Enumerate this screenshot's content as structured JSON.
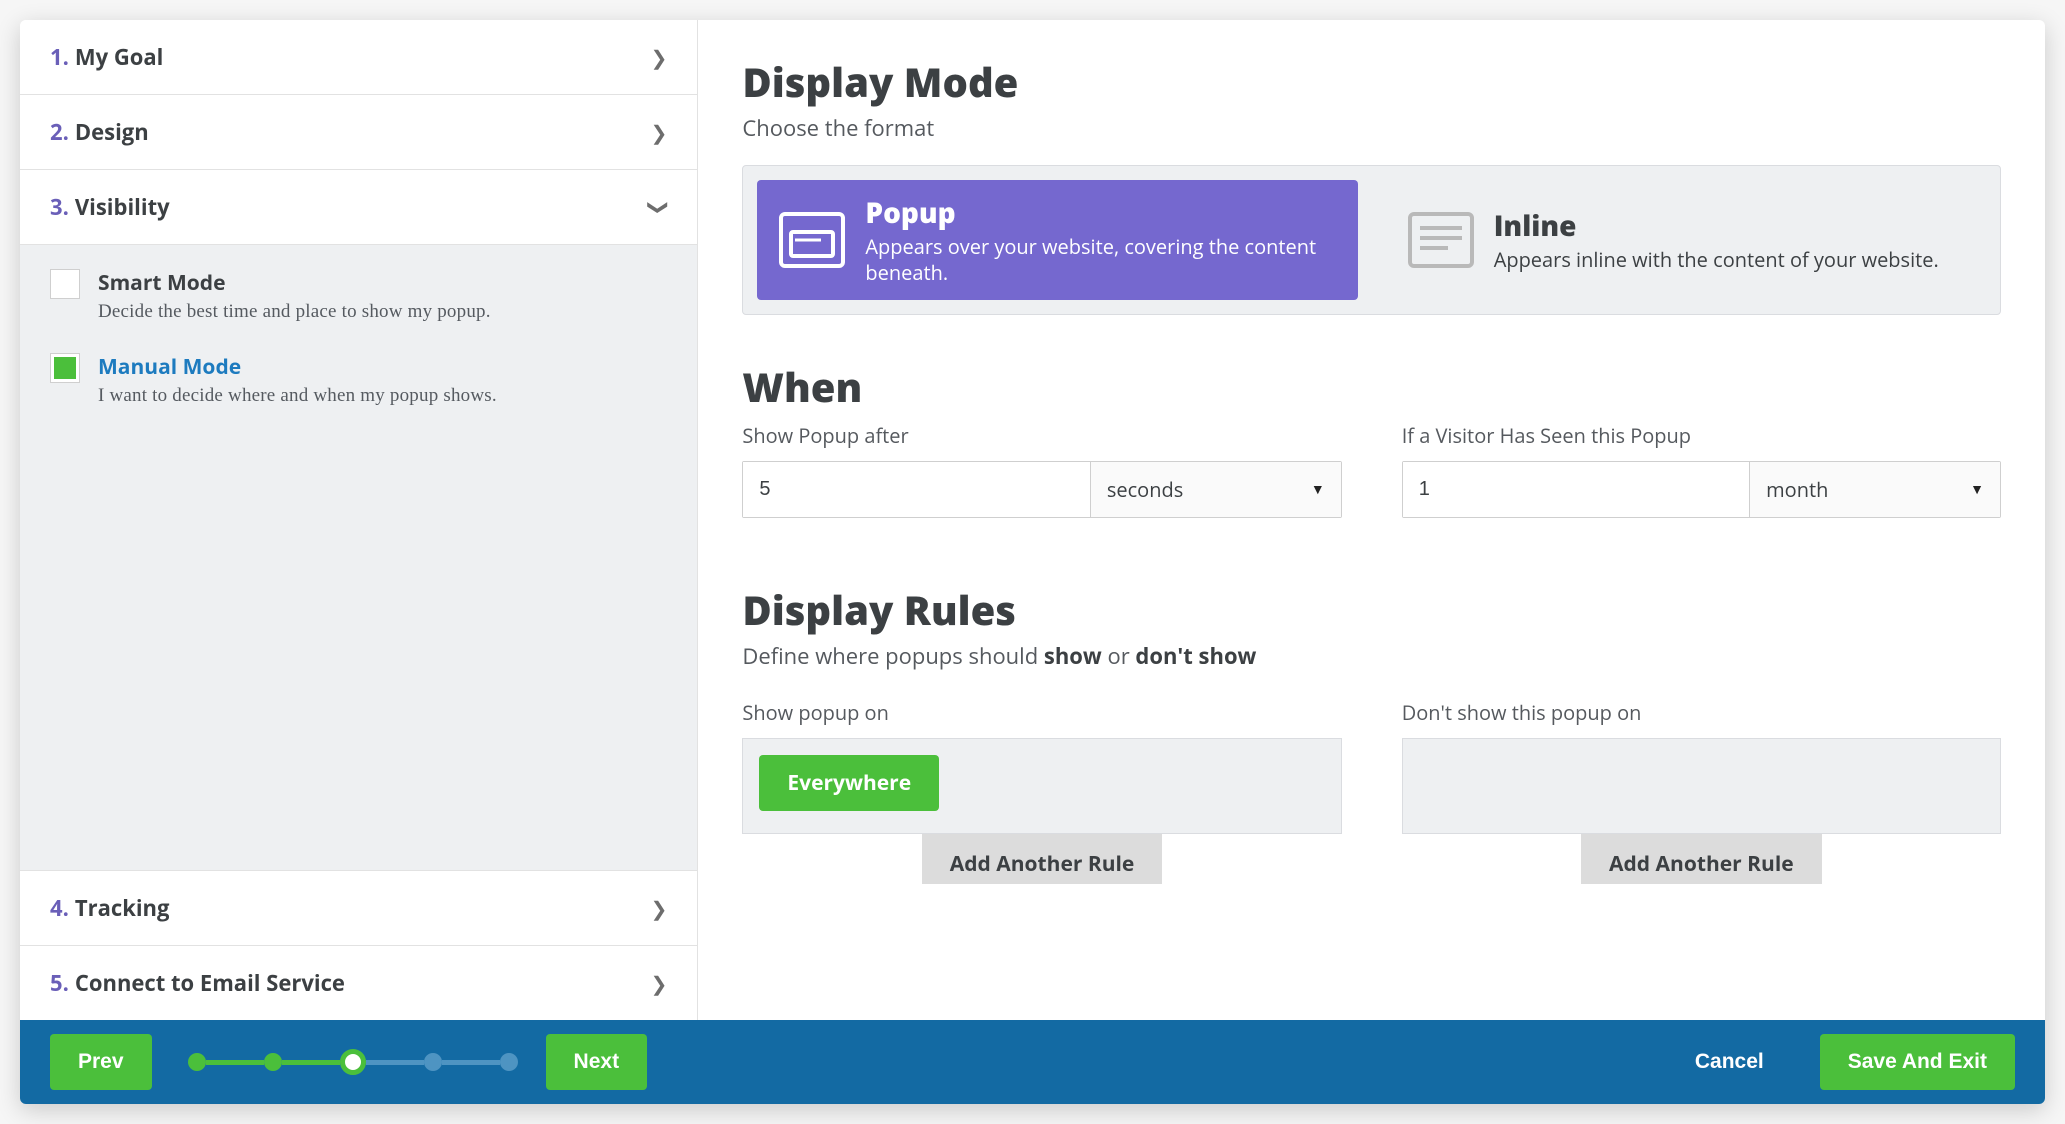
{
  "sidebar": {
    "steps": [
      {
        "num": "1.",
        "label": "My Goal"
      },
      {
        "num": "2.",
        "label": "Design"
      },
      {
        "num": "3.",
        "label": "Visibility"
      },
      {
        "num": "4.",
        "label": "Tracking"
      },
      {
        "num": "5.",
        "label": "Connect to Email Service"
      }
    ],
    "smart": {
      "title": "Smart Mode",
      "desc": "Decide the best time and place to show my popup."
    },
    "manual": {
      "title": "Manual Mode",
      "desc": "I want to decide where and when my popup shows."
    }
  },
  "display_mode": {
    "title": "Display Mode",
    "subtitle": "Choose the format",
    "popup": {
      "title": "Popup",
      "desc": "Appears over your website, covering the content beneath."
    },
    "inline": {
      "title": "Inline",
      "desc": "Appears inline with the content of your website."
    }
  },
  "when": {
    "title": "When",
    "show_after_label": "Show Popup after",
    "show_after_value": "5",
    "show_after_unit": "seconds",
    "visitor_seen_label": "If a Visitor Has Seen this Popup",
    "visitor_seen_value": "1",
    "visitor_seen_unit": "month"
  },
  "rules": {
    "title": "Display Rules",
    "subtitle_pre": "Define where popups should ",
    "subtitle_show": "show",
    "subtitle_or": " or ",
    "subtitle_dont": "don't show",
    "show_label": "Show popup on",
    "show_tag": "Everywhere",
    "dont_label": "Don't show this popup on",
    "add_rule": "Add Another Rule"
  },
  "footer": {
    "prev": "Prev",
    "next": "Next",
    "cancel": "Cancel",
    "save": "Save And Exit"
  }
}
